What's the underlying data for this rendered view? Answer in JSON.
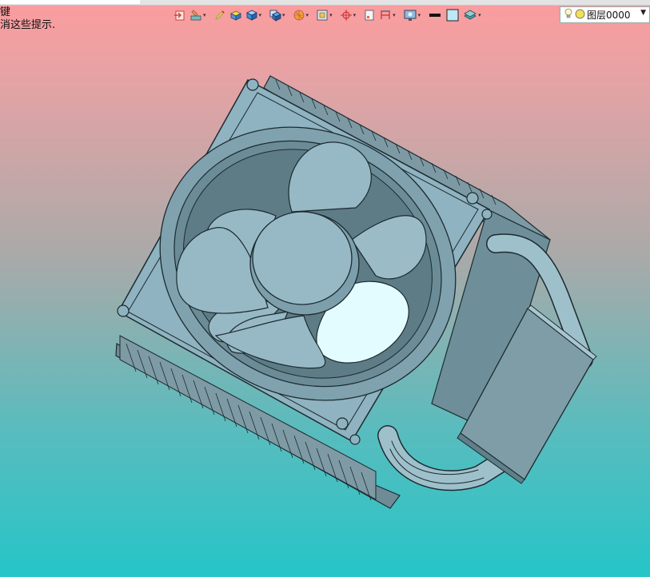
{
  "hint": {
    "line1": "键",
    "line2": "消这些提示."
  },
  "layer": {
    "name": "图层0000"
  },
  "toolbar": {
    "icons": [
      "exit-icon",
      "paint-icon",
      "pencil-icon",
      "box-yellow-icon",
      "cube-blue-icon",
      "cube-solid-icon",
      "sphere-orange-icon",
      "frame-icon",
      "target-icon",
      "page-icon",
      "bracket-icon",
      "monitor-icon",
      "line-black-icon",
      "swatch-icon",
      "layers-icon"
    ]
  },
  "colors": {
    "part_face": "#8fb3c0",
    "part_highlight": "#e3fcff",
    "part_shadow": "#6e8f99",
    "edge": "#1c2a30"
  }
}
